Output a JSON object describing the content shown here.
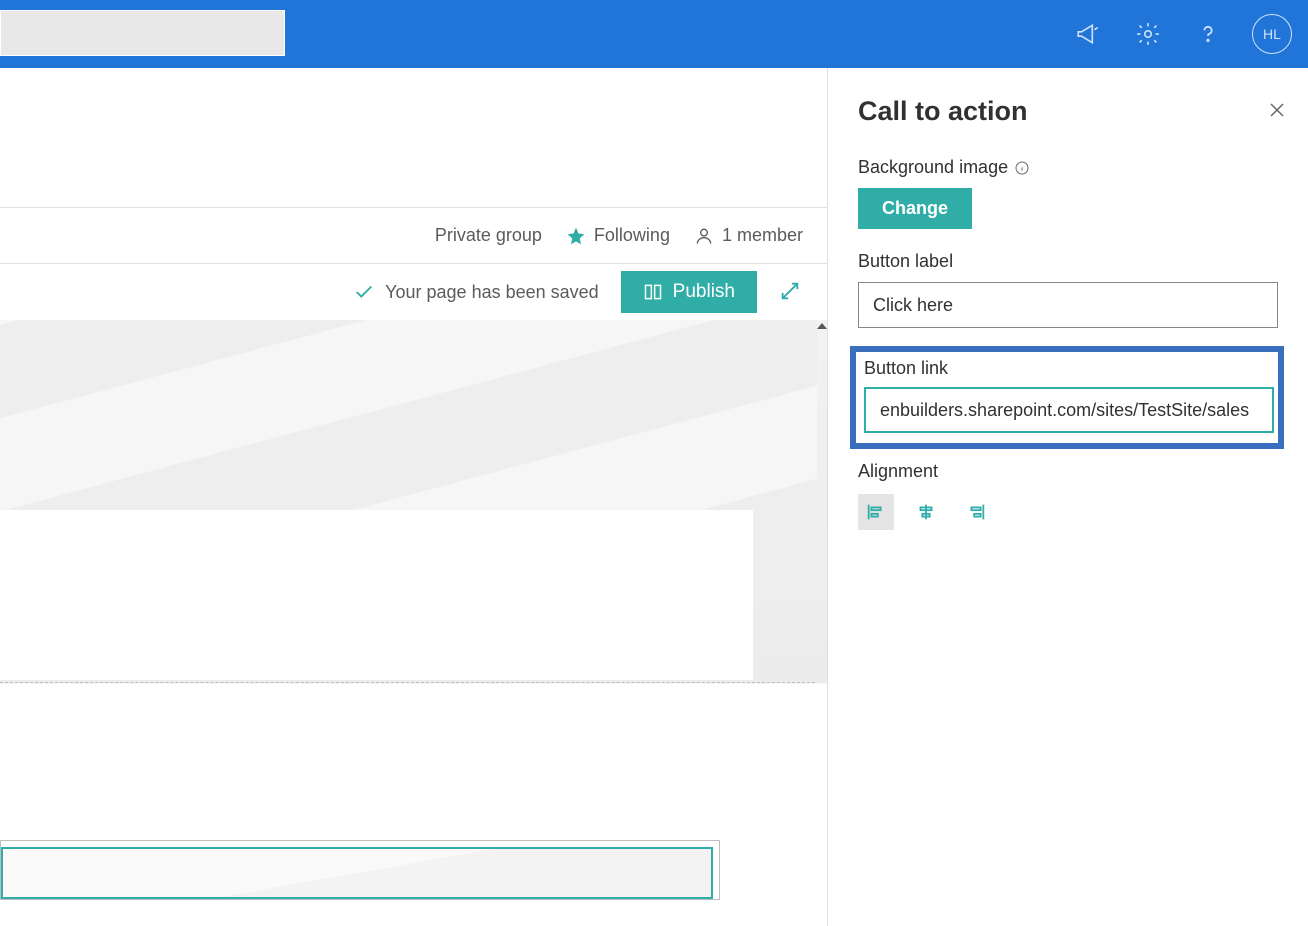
{
  "header": {
    "avatar_initials": "HL"
  },
  "info_row": {
    "group_type": "Private group",
    "following_label": "Following",
    "members_label": "1 member"
  },
  "action_row": {
    "saved_message": "Your page has been saved",
    "publish_label": "Publish"
  },
  "panel": {
    "title": "Call to action",
    "bg_label": "Background image",
    "change_label": "Change",
    "button_label_label": "Button label",
    "button_label_value": "Click here",
    "button_link_label": "Button link",
    "button_link_value": "enbuilders.sharepoint.com/sites/TestSite/sales",
    "alignment_label": "Alignment"
  },
  "colors": {
    "brand_blue": "#2174d8",
    "teal": "#30ada7",
    "highlight": "#3a6ebf"
  }
}
